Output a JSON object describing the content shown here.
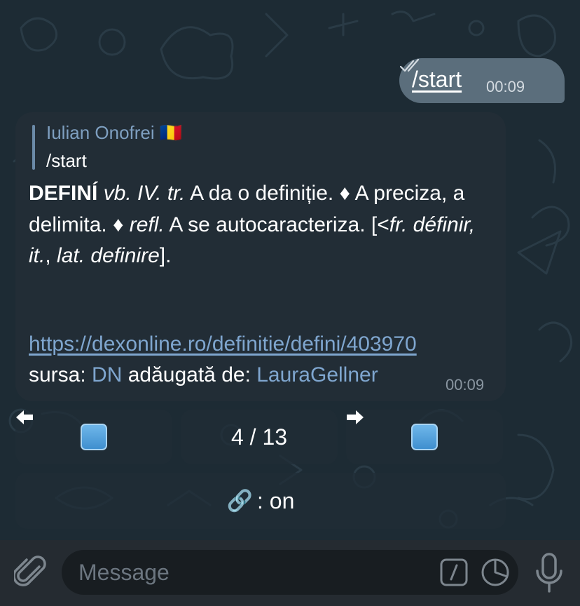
{
  "outgoing_message": {
    "text": "/start",
    "time": "00:09"
  },
  "incoming_message": {
    "reply": {
      "author": "Iulian Onofrei",
      "author_flag": "🇷🇴",
      "text": "/start"
    },
    "definition": {
      "headword": "DEFINÍ",
      "grammar": "vb. IV. tr.",
      "sense1": "A da o definiție.",
      "sense2": "A preciza, a delimita.",
      "refl_label": "refl.",
      "sense3": "A se autocaracteriza.",
      "etym_open": "[<",
      "etym_fr": "fr. définir, it.",
      "etym_comma": ",",
      "etym_lat": "lat. definire",
      "etym_close": "]."
    },
    "link": "https://dexonline.ro/definitie/defini/403970",
    "source_label": "sursa:",
    "source_name": "DN",
    "added_by_label": "adăugată de:",
    "added_by_name": "LauraGellner",
    "time": "00:09"
  },
  "keyboard": {
    "prev_icon": "left-arrow-emoji",
    "page_indicator": "4 / 13",
    "next_icon": "right-arrow-emoji",
    "link_toggle_emoji": "🔗",
    "link_toggle_text": ": on"
  },
  "input_bar": {
    "placeholder": "Message"
  },
  "colors": {
    "chat_background": "#1d2b34",
    "outgoing_bubble": "#5b6e7c",
    "incoming_bubble": "#222d36",
    "link": "#7fa6cf",
    "reply_name": "#7e9fc0"
  }
}
